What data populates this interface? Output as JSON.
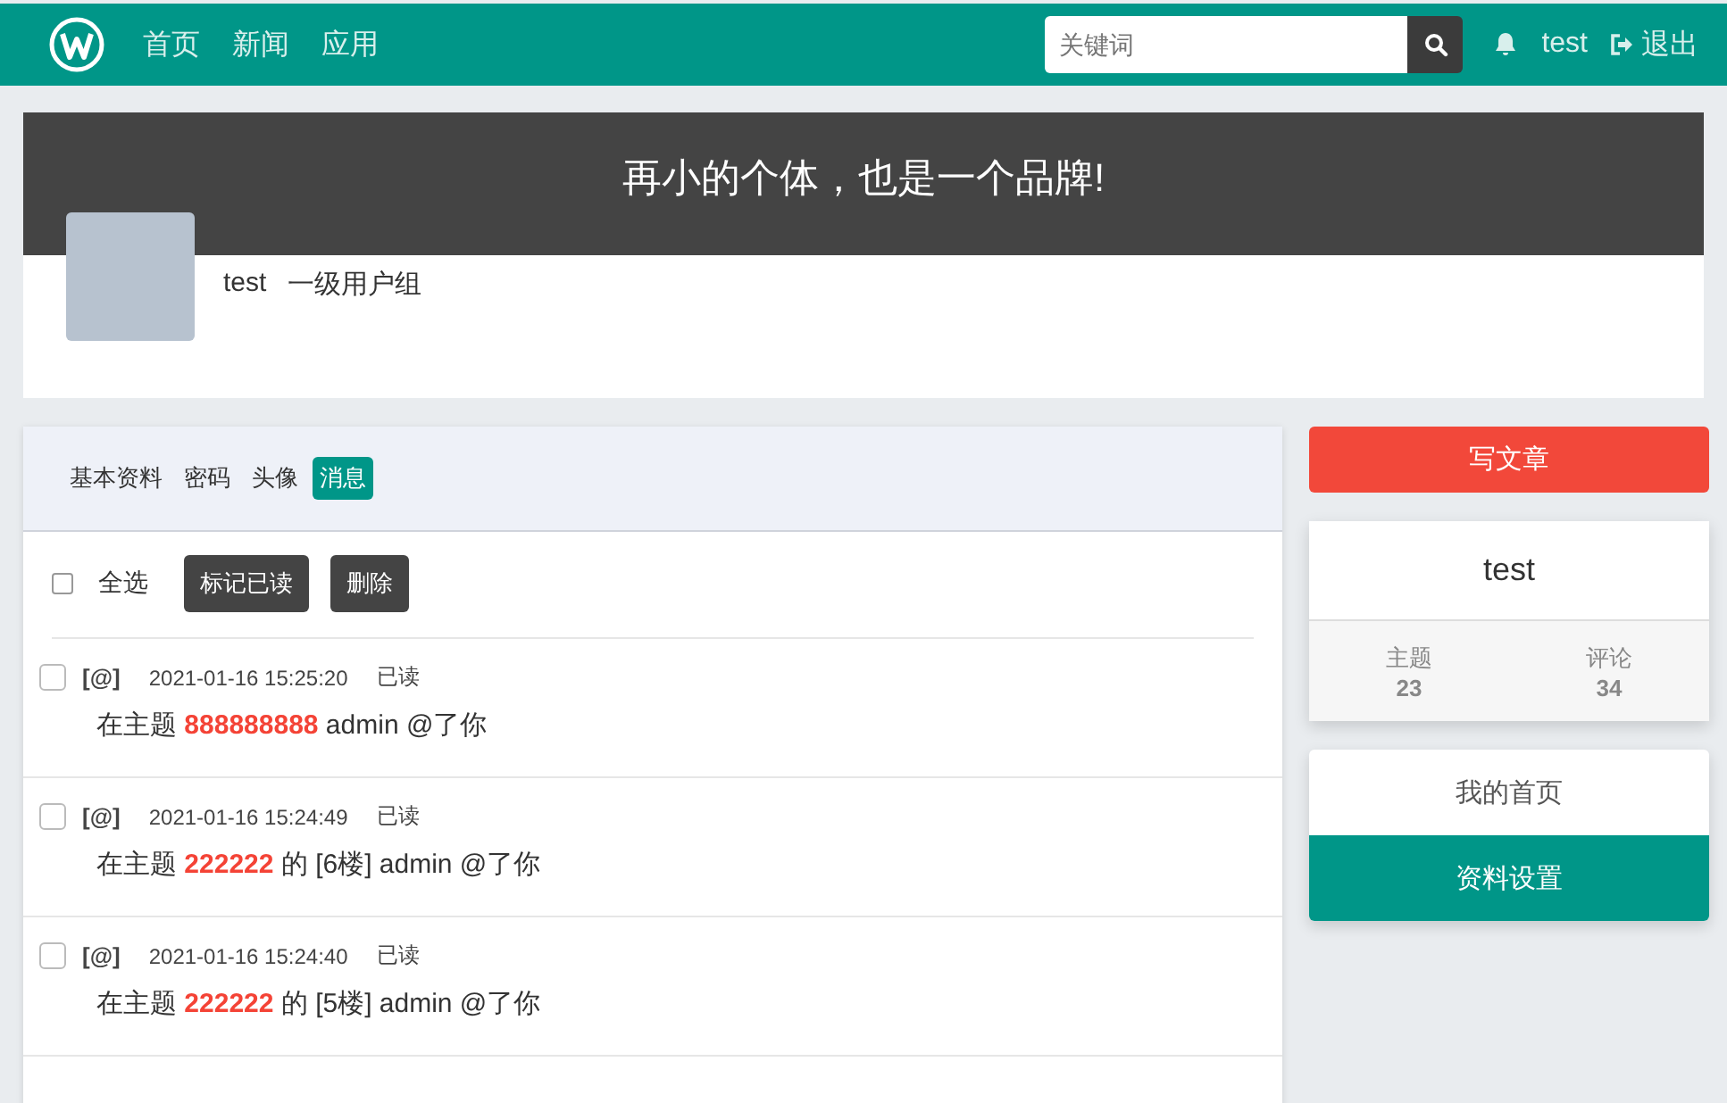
{
  "navbar": {
    "nav_links": [
      "首页",
      "新闻",
      "应用"
    ],
    "search": {
      "placeholder": "关键词"
    },
    "username": "test",
    "logout": "退出"
  },
  "banner": {
    "slogan": "再小的个体，也是一个品牌!",
    "username": "test",
    "group": "一级用户组"
  },
  "tabs": [
    {
      "label": "基本资料",
      "selected": false
    },
    {
      "label": "密码",
      "selected": false
    },
    {
      "label": "头像",
      "selected": false
    },
    {
      "label": "消息",
      "selected": true
    }
  ],
  "toolbar": {
    "select_all": {
      "label": "全选",
      "checked": false
    },
    "buttons": [
      "标记已读",
      "删除"
    ]
  },
  "messages": [
    {
      "tag": "[@]",
      "time": "2021-01-16 15:25:20",
      "status": "已读",
      "checked": false,
      "text": "在主题 **888888888** admin @了你"
    },
    {
      "tag": "[@]",
      "time": "2021-01-16 15:24:49",
      "status": "已读",
      "checked": false,
      "text": "在主题 **222222** 的 [6楼] admin @了你"
    },
    {
      "tag": "[@]",
      "time": "2021-01-16 15:24:40",
      "status": "已读",
      "checked": false,
      "text": "在主题 **222222** 的 [5楼] admin @了你"
    }
  ],
  "sidebar": {
    "write_button": "写文章",
    "profile": {
      "username": "test",
      "stats": [
        {
          "label": "主题",
          "value": "23"
        },
        {
          "label": "评论",
          "value": "34"
        }
      ]
    },
    "menu": [
      {
        "label": "我的首页",
        "selected": false
      },
      {
        "label": "资料设置",
        "selected": true
      }
    ]
  }
}
